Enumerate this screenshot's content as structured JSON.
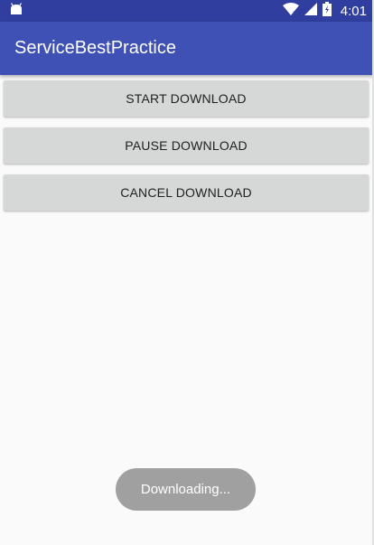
{
  "status_bar": {
    "time": "4:01",
    "icons": [
      "android-icon",
      "wifi-icon",
      "signal-icon",
      "battery-icon"
    ],
    "background": "#303f9f"
  },
  "app_bar": {
    "title": "ServiceBestPractice",
    "background": "#3f51b5"
  },
  "buttons": {
    "start_label": "START DOWNLOAD",
    "pause_label": "PAUSE DOWNLOAD",
    "cancel_label": "CANCEL DOWNLOAD"
  },
  "toast": {
    "message": "Downloading..."
  }
}
